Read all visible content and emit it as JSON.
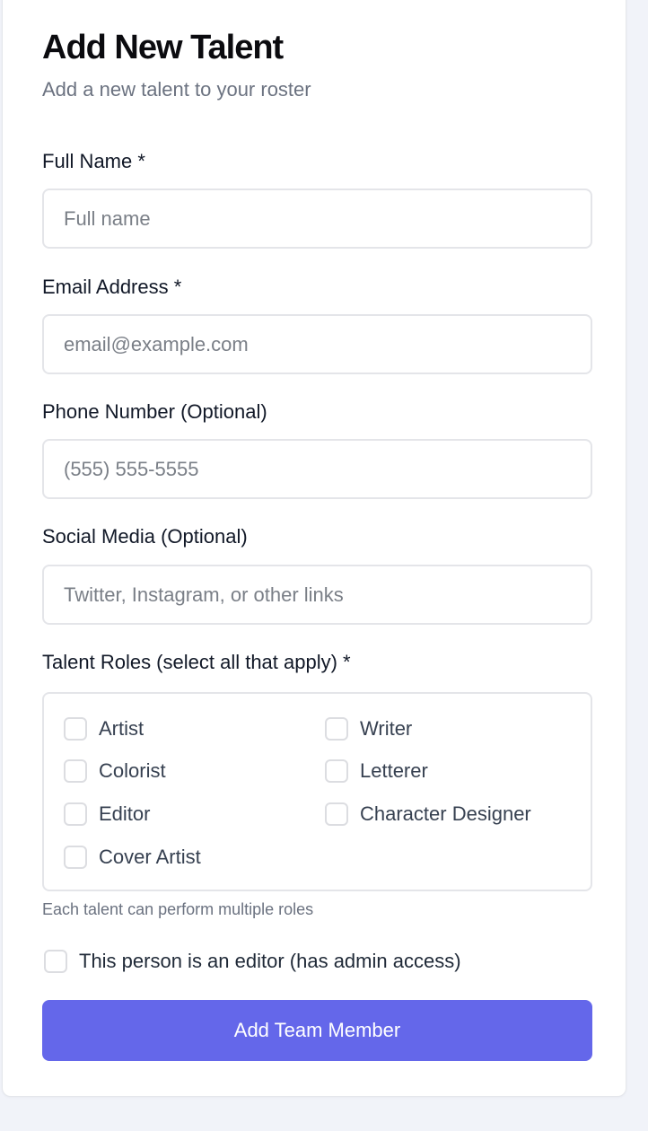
{
  "form": {
    "title": "Add New Talent",
    "subtitle": "Add a new talent to your roster",
    "fields": {
      "full_name": {
        "label": "Full Name *",
        "placeholder": "Full name",
        "value": ""
      },
      "email": {
        "label": "Email Address *",
        "placeholder": "email@example.com",
        "value": ""
      },
      "phone": {
        "label": "Phone Number (Optional)",
        "placeholder": "(555) 555-5555",
        "value": ""
      },
      "social": {
        "label": "Social Media (Optional)",
        "placeholder": "Twitter, Instagram, or other links",
        "value": ""
      }
    },
    "roles": {
      "label": "Talent Roles (select all that apply) *",
      "items": [
        {
          "label": "Artist",
          "checked": false
        },
        {
          "label": "Writer",
          "checked": false
        },
        {
          "label": "Colorist",
          "checked": false
        },
        {
          "label": "Letterer",
          "checked": false
        },
        {
          "label": "Editor",
          "checked": false
        },
        {
          "label": "Character Designer",
          "checked": false
        },
        {
          "label": "Cover Artist",
          "checked": false
        }
      ],
      "helper": "Each talent can perform multiple roles"
    },
    "editor_checkbox": {
      "label": "This person is an editor (has admin access)",
      "checked": false
    },
    "submit_label": "Add Team Member"
  },
  "colors": {
    "page_background": "#f1f3f9",
    "card_background": "#ffffff",
    "border": "#e4e5e9",
    "accent": "#6467ea",
    "muted_text": "#6b7280"
  }
}
